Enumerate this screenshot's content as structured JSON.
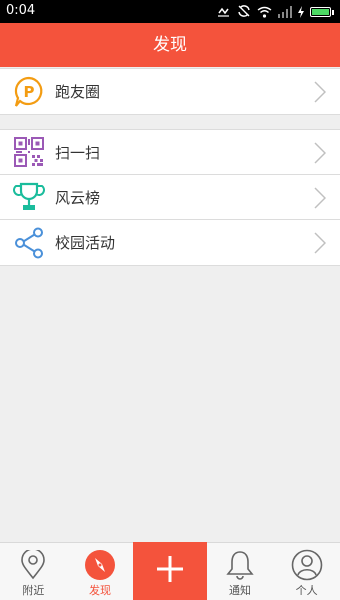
{
  "status_bar": {
    "time": "0:04",
    "icons": [
      "dnd-icon",
      "rotate-icon",
      "wifi-icon",
      "signal-icon",
      "charging-icon",
      "battery-icon"
    ]
  },
  "header": {
    "title": "发现"
  },
  "menu": {
    "group1": [
      {
        "label": "跑友圈",
        "icon": "moments-p-icon"
      }
    ],
    "group2": [
      {
        "label": "扫一扫",
        "icon": "qr-code-icon"
      },
      {
        "label": "风云榜",
        "icon": "trophy-icon"
      },
      {
        "label": "校园活动",
        "icon": "share-icon"
      }
    ]
  },
  "tab_bar": {
    "tabs": [
      {
        "label": "附近",
        "icon": "location-pin-icon"
      },
      {
        "label": "发现",
        "icon": "compass-icon",
        "active": true
      },
      {
        "label": "",
        "icon": "plus-icon"
      },
      {
        "label": "通知",
        "icon": "bell-icon"
      },
      {
        "label": "个人",
        "icon": "person-icon"
      }
    ]
  },
  "colors": {
    "accent": "#f4533c",
    "orange_icon": "#f39c12",
    "purple_icon": "#9b59b6",
    "teal_icon": "#1abc9c",
    "blue_icon": "#4a90d9"
  }
}
